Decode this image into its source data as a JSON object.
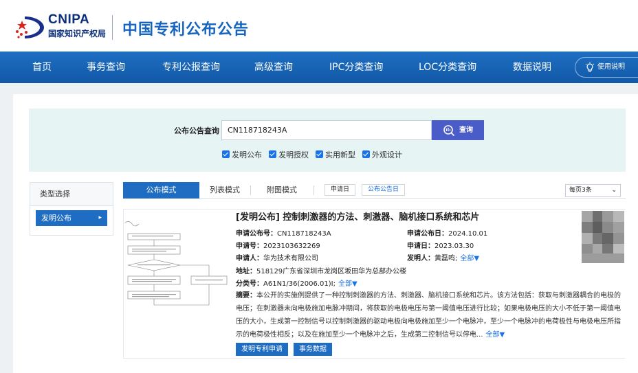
{
  "header": {
    "logo_en": "CNIPA",
    "logo_cn": "国家知识产权局",
    "site_title": "中国专利公布公告"
  },
  "nav": {
    "items": [
      "首页",
      "事务查询",
      "专利公报查询",
      "高级查询",
      "IPC分类查询",
      "LOC分类查询",
      "数据说明"
    ],
    "help_label": "使用说明",
    "help_icon": "lightbulb-icon"
  },
  "search": {
    "label": "公布公告查询",
    "value": "CN118718243A",
    "button_label": "查询",
    "checkboxes": [
      {
        "label": "发明公布",
        "checked": true
      },
      {
        "label": "发明授权",
        "checked": true
      },
      {
        "label": "实用新型",
        "checked": true
      },
      {
        "label": "外观设计",
        "checked": true
      }
    ]
  },
  "sidebar": {
    "heading": "类型选择",
    "items": [
      {
        "label": "发明公布",
        "active": true
      }
    ]
  },
  "tabs": {
    "modes": [
      "公布模式",
      "列表模式",
      "附图模式"
    ],
    "active": "公布模式",
    "sort": [
      "申请日",
      "公布公告日"
    ],
    "per_page": "每页3条"
  },
  "result": {
    "title": "[发明公布] 控制刺激器的方法、刺激器、脑机接口系统和芯片",
    "pub_no_label": "申请公布号：",
    "pub_no": "CN118718243A",
    "pub_date_label": "申请公布日：",
    "pub_date": "2024.10.01",
    "app_no_label": "申请号：",
    "app_no": "2023103632269",
    "app_date_label": "申请日：",
    "app_date": "2023.03.30",
    "applicant_label": "申请人：",
    "applicant": "华为技术有限公司",
    "inventor_label": "发明人：",
    "inventor": "黄磊鸣;",
    "more_label": "全部▼",
    "address_label": "地址：",
    "address": "518129广东省深圳市龙岗区坂田华为总部办公楼",
    "class_label": "分类号：",
    "class_no": "A61N1/36(2006.01)I;",
    "abstract_label": "摘要：",
    "abstract": "本公开的实施例提供了一种控制刺激器的方法、刺激器、脑机接口系统和芯片。该方法包括：获取与刺激器耦合的电极的电压；在刺激器未向电极施加电脉冲期间，将获取的电极电压与第一阈值电压进行比较；如果电极电压的大小不低于第一阈值电压的大小，生成第一控制信号以控制刺激器的驱动电极向电极施加至少一个电脉冲，至少一个电脉冲的电荷极性与电极电压所指示的电荷极性相反；以及在施加至少一个电脉冲之后，生成第二控制信号以停电...",
    "buttons": [
      "发明专利申请",
      "事务数据"
    ]
  },
  "colors": {
    "nav_bg": "#1a66b8",
    "accent": "#1f6cc3",
    "search_btn": "#4a5cc8",
    "title_blue": "#1565c0"
  }
}
